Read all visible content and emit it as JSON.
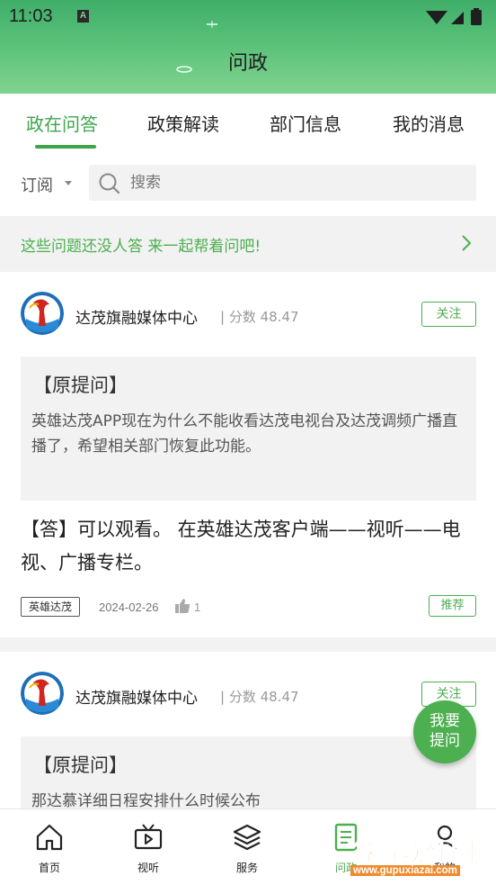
{
  "status_bar": {
    "time": "11:03",
    "notif_letter": "A"
  },
  "header": {
    "title": "问政"
  },
  "tabs": [
    {
      "label": "政在问答",
      "active": true
    },
    {
      "label": "政策解读",
      "active": false
    },
    {
      "label": "部门信息",
      "active": false
    },
    {
      "label": "我的消息",
      "active": false
    }
  ],
  "filter": {
    "subscribe_label": "订阅",
    "search_placeholder": "搜索",
    "search_value": ""
  },
  "banner": {
    "text": "这些问题还没人答 来一起帮着问吧!"
  },
  "posts": [
    {
      "org_name": "达茂旗融媒体中心",
      "score": "| 分数 48.47",
      "follow_label": "关注",
      "quote_title": "【原提问】",
      "quote_text": "英雄达茂APP现在为什么不能收看达茂电视台及达茂调频广播直播了，希望相关部门恢复此功能。",
      "answer": "【答】可以观看。 在英雄达茂客户端——视听——电视、广播专栏。",
      "tag": "英雄达茂",
      "date": "2024-02-26",
      "likes": "1",
      "recommend_label": "推荐"
    },
    {
      "org_name": "达茂旗融媒体中心",
      "score": "| 分数 48.47",
      "follow_label": "关注",
      "quote_title": "【原提问】",
      "quote_text": "那达慕详细日程安排什么时候公布"
    }
  ],
  "fab": {
    "line1": "我要",
    "line2": "提问"
  },
  "bottom_nav": [
    {
      "label": "首页",
      "icon": "home-icon"
    },
    {
      "label": "视听",
      "icon": "tv-icon"
    },
    {
      "label": "服务",
      "icon": "layers-icon"
    },
    {
      "label": "问政",
      "icon": "document-icon",
      "active": true
    },
    {
      "label": "我的",
      "icon": "user-icon"
    }
  ],
  "watermark": {
    "brand": "谷普软件园",
    "url": "www.gupuxiazai.com"
  },
  "colors": {
    "accent": "#4caf50",
    "header_top": "#3fae6a",
    "header_bottom": "#7fd48f"
  }
}
